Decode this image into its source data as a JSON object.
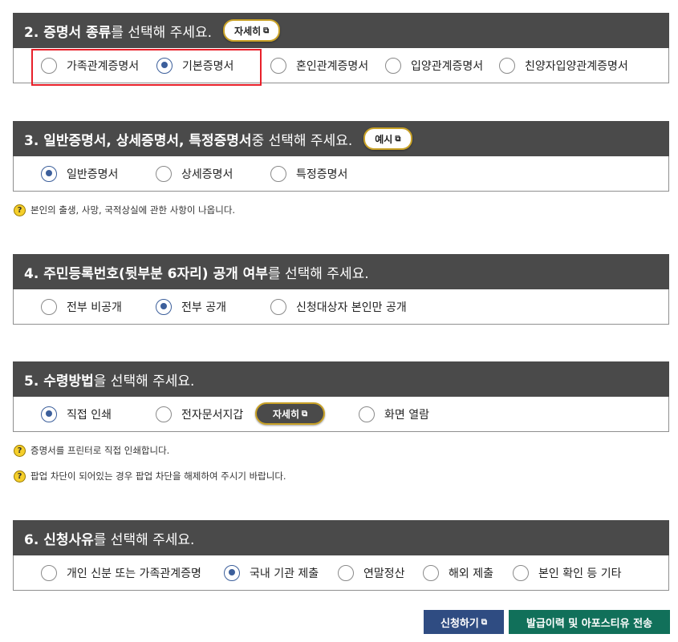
{
  "sections": [
    {
      "bold": "2. 증명서 종류",
      "rest": "를 선택해 주세요.",
      "pill": "자세히",
      "options": [
        {
          "label": "가족관계증명서",
          "selected": false
        },
        {
          "label": "기본증명서",
          "selected": true
        },
        {
          "label": "혼인관계증명서",
          "selected": false
        },
        {
          "label": "입양관계증명서",
          "selected": false
        },
        {
          "label": "친양자입양관계증명서",
          "selected": false
        }
      ]
    },
    {
      "bold": "3. 일반증명서, 상세증명서, 특정증명서",
      "rest": " 중 선택해 주세요.",
      "pill": "예시",
      "options": [
        {
          "label": "일반증명서",
          "selected": true
        },
        {
          "label": "상세증명서",
          "selected": false
        },
        {
          "label": "특정증명서",
          "selected": false
        }
      ],
      "notes": [
        "본인의 출생, 사망, 국적상실에 관한 사항이 나옵니다."
      ]
    },
    {
      "bold": "4. 주민등록번호(뒷부분 6자리) 공개 여부",
      "rest": "를 선택해 주세요.",
      "options": [
        {
          "label": "전부 비공개",
          "selected": false
        },
        {
          "label": "전부 공개",
          "selected": true
        },
        {
          "label": "신청대상자 본인만 공개",
          "selected": false
        }
      ]
    },
    {
      "bold": "5. 수령방법",
      "rest": "을 선택해 주세요.",
      "inline_pill": "자세히",
      "options": [
        {
          "label": "직접 인쇄",
          "selected": true
        },
        {
          "label": "전자문서지갑",
          "selected": false
        },
        {
          "label": "화면 열람",
          "selected": false
        }
      ],
      "notes": [
        "증명서를 프린터로 직접 인쇄합니다.",
        "팝업 차단이 되어있는 경우 팝업 차단을 해제하여 주시기 바랍니다."
      ]
    },
    {
      "bold": "6. 신청사유",
      "rest": "를 선택해 주세요.",
      "options": [
        {
          "label": "개인 신분 또는 가족관계증명",
          "selected": false
        },
        {
          "label": "국내 기관 제출",
          "selected": true
        },
        {
          "label": "연말정산",
          "selected": false
        },
        {
          "label": "해외 제출",
          "selected": false
        },
        {
          "label": "본인 확인 등 기타",
          "selected": false
        }
      ]
    }
  ],
  "help_icon": "question-circle-icon",
  "external_icon": "external-link-icon",
  "buttons": {
    "apply": "신청하기",
    "history": "발급이력 및 아포스티유 전송"
  },
  "colors": {
    "header_bg": "#4a4a4a",
    "radio_selected": "#3c5f9b",
    "highlight": "#e8202a",
    "apply_btn": "#2f4c82",
    "history_btn": "#11705a"
  }
}
